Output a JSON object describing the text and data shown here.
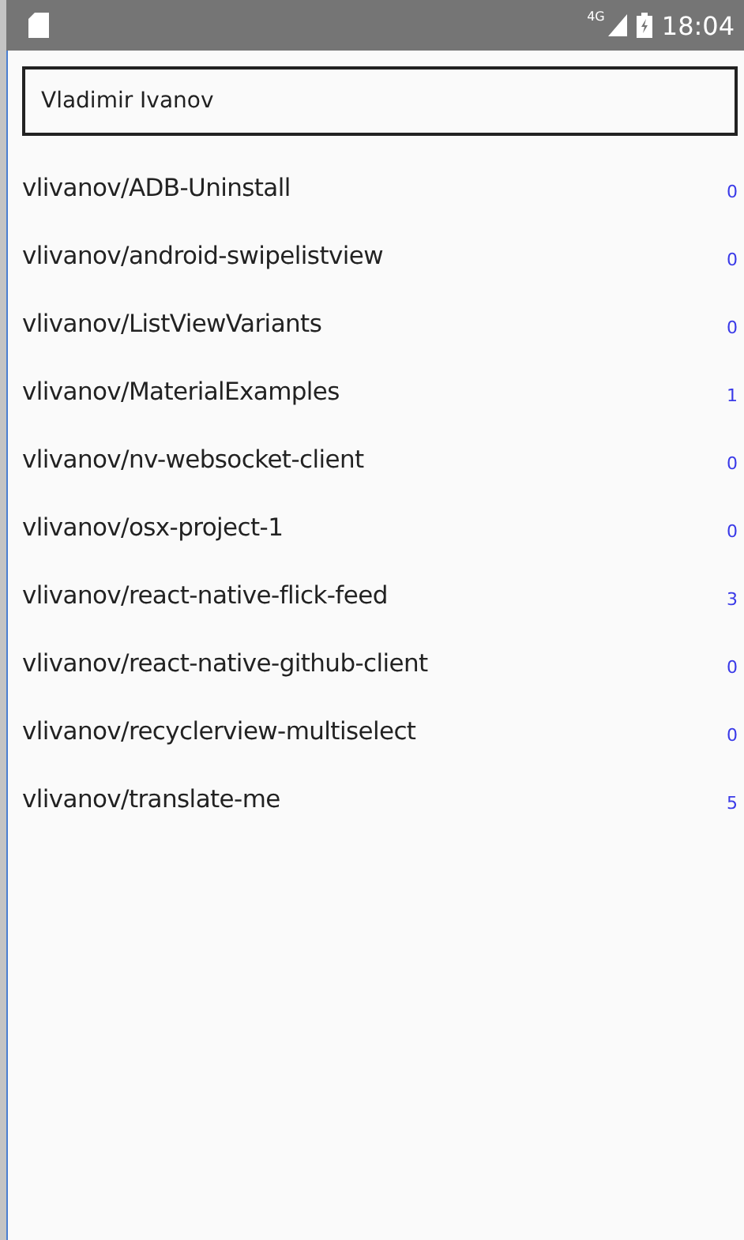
{
  "status_bar": {
    "network": "4G",
    "time": "18:04"
  },
  "search": {
    "value": "Vladimir Ivanov"
  },
  "repos": [
    {
      "name": "vlivanov/ADB-Uninstall",
      "count": "0"
    },
    {
      "name": "vlivanov/android-swipelistview",
      "count": "0"
    },
    {
      "name": "vlivanov/ListViewVariants",
      "count": "0"
    },
    {
      "name": "vlivanov/MaterialExamples",
      "count": "1"
    },
    {
      "name": "vlivanov/nv-websocket-client",
      "count": "0"
    },
    {
      "name": "vlivanov/osx-project-1",
      "count": "0"
    },
    {
      "name": "vlivanov/react-native-flick-feed",
      "count": "3"
    },
    {
      "name": "vlivanov/react-native-github-client",
      "count": "0"
    },
    {
      "name": "vlivanov/recyclerview-multiselect",
      "count": "0"
    },
    {
      "name": "vlivanov/translate-me",
      "count": "5"
    }
  ]
}
